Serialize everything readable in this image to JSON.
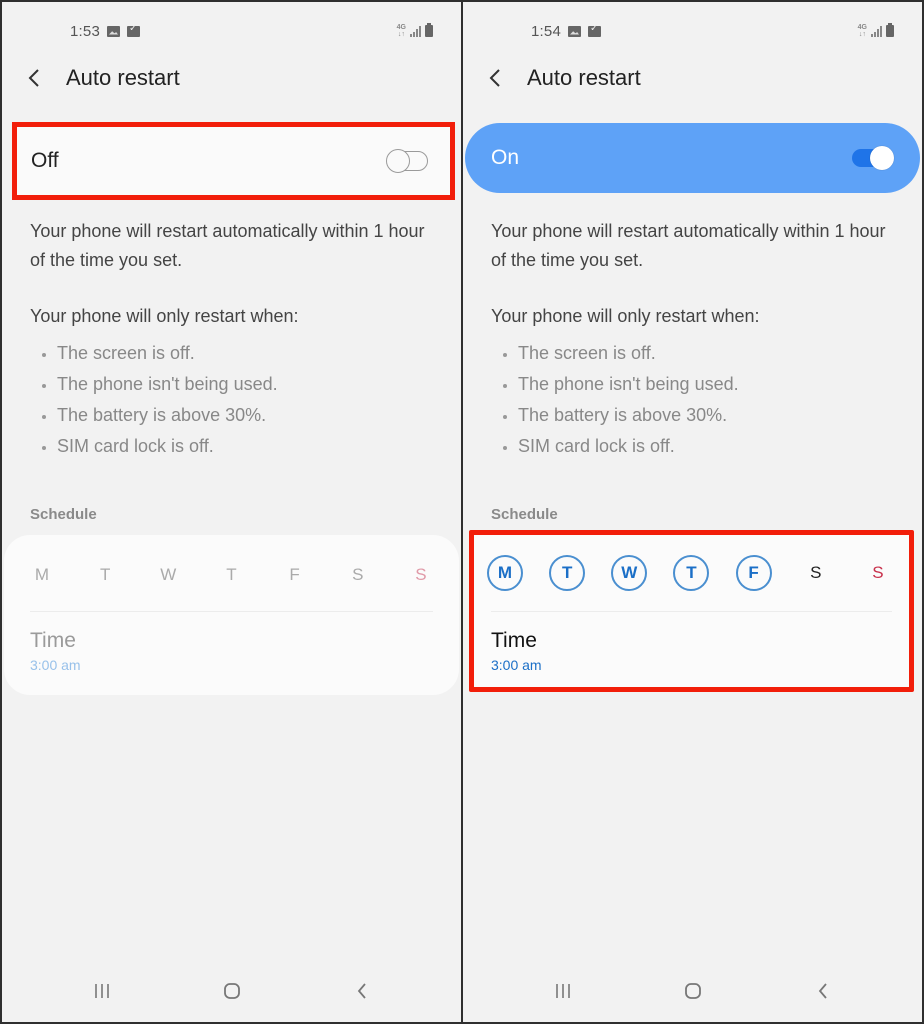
{
  "panels": [
    {
      "status": {
        "time": "1:53",
        "network": "4G",
        "icons": [
          "image-icon",
          "check-icon",
          "network-4g-icon",
          "signal-icon",
          "battery-icon"
        ]
      },
      "header": {
        "title": "Auto restart",
        "back_icon": "back-chevron-icon"
      },
      "master_switch": {
        "label": "Off",
        "state": "off",
        "highlighted": true
      },
      "description": "Your phone will restart automatically within 1 hour of the time you set.",
      "conditions_title": "Your phone will only restart when:",
      "conditions": [
        "The screen is off.",
        "The phone isn't being used.",
        "The battery is above 30%.",
        "SIM card lock is off."
      ],
      "schedule": {
        "label": "Schedule",
        "enabled": false,
        "days": [
          {
            "label": "M",
            "selected": false
          },
          {
            "label": "T",
            "selected": false
          },
          {
            "label": "W",
            "selected": false
          },
          {
            "label": "T",
            "selected": false
          },
          {
            "label": "F",
            "selected": false
          },
          {
            "label": "S",
            "selected": false
          },
          {
            "label": "S",
            "selected": false,
            "sunday": true
          }
        ],
        "time_label": "Time",
        "time_value": "3:00 am"
      },
      "nav": [
        "recent-apps-icon",
        "home-icon",
        "back-icon"
      ]
    },
    {
      "status": {
        "time": "1:54",
        "network": "4G",
        "icons": [
          "image-icon",
          "check-icon",
          "network-4g-icon",
          "signal-icon",
          "battery-icon"
        ]
      },
      "header": {
        "title": "Auto restart",
        "back_icon": "back-chevron-icon"
      },
      "master_switch": {
        "label": "On",
        "state": "on",
        "highlighted": false
      },
      "description": "Your phone will restart automatically within 1 hour of the time you set.",
      "conditions_title": "Your phone will only restart when:",
      "conditions": [
        "The screen is off.",
        "The phone isn't being used.",
        "The battery is above 30%.",
        "SIM card lock is off."
      ],
      "schedule": {
        "label": "Schedule",
        "enabled": true,
        "highlighted": true,
        "days": [
          {
            "label": "M",
            "selected": true
          },
          {
            "label": "T",
            "selected": true
          },
          {
            "label": "W",
            "selected": true
          },
          {
            "label": "T",
            "selected": true
          },
          {
            "label": "F",
            "selected": true
          },
          {
            "label": "S",
            "selected": false
          },
          {
            "label": "S",
            "selected": false,
            "sunday": true
          }
        ],
        "time_label": "Time",
        "time_value": "3:00 am"
      },
      "nav": [
        "recent-apps-icon",
        "home-icon",
        "back-icon"
      ]
    }
  ],
  "colors": {
    "highlight_red": "#f21e0a",
    "switch_on_bg": "#5ea2f7",
    "switch_on_track": "#1f74e8",
    "selected_day": "#1b6fc7",
    "sunday_red": "#c8304b",
    "background": "#f2f2f2"
  }
}
